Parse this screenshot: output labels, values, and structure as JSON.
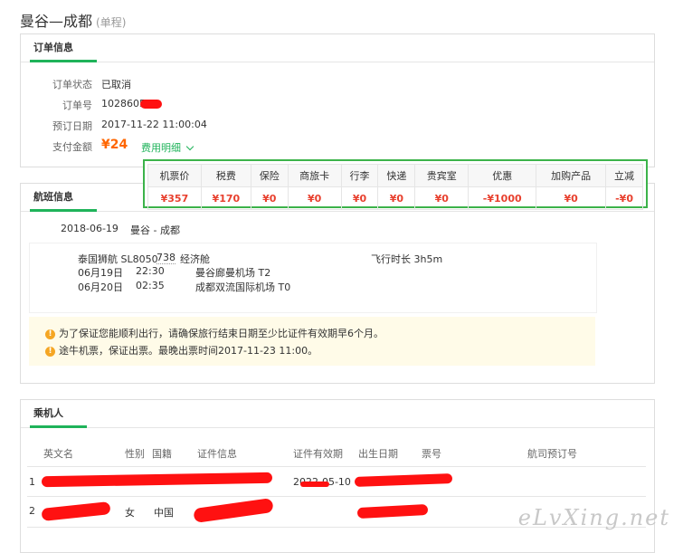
{
  "header": {
    "route_title": "曼谷—成都",
    "trip_type": "(单程)"
  },
  "order_info": {
    "tab_label": "订单信息",
    "status_label": "订单状态",
    "status_value": "已取消",
    "order_no_label": "订单号",
    "order_no_value": "1028605",
    "date_label": "预订日期",
    "date_value": "2017-11-22 11:00:04",
    "amount_label": "支付金额",
    "amount_value": "¥24",
    "fee_detail_link": "费用明细"
  },
  "fee_table": {
    "headers": [
      "机票价",
      "税费",
      "保险",
      "商旅卡",
      "行李",
      "快递",
      "贵宾室",
      "优惠",
      "加购产品",
      "立减"
    ],
    "values": [
      "¥357",
      "¥170",
      "¥0",
      "¥0",
      "¥0",
      "¥0",
      "¥0",
      "-¥1000",
      "¥0",
      "-¥0"
    ]
  },
  "flight_info": {
    "tab_label": "航班信息",
    "date": "2018-06-19",
    "route": "曼谷 - 成都",
    "airline": "泰国狮航 SL8050",
    "aircraft": "738",
    "cabin": "经济舱",
    "duration": "飞行时长 3h5m",
    "dep_date": "06月19日",
    "dep_time": "22:30",
    "dep_airport": "曼谷廊曼机场 T2",
    "arr_date": "06月20日",
    "arr_time": "02:35",
    "arr_airport": "成都双流国际机场 T0",
    "notice_1": "为了保证您能顺利出行，请确保旅行结束日期至少比证件有效期早6个月。",
    "notice_2": "途牛机票，保证出票。最晚出票时间2017-11-23 11:00。"
  },
  "passengers": {
    "tab_label": "乘机人",
    "headers": {
      "name": "英文名",
      "gender": "性别",
      "nationality": "国籍",
      "id_info": "证件信息",
      "id_expiry": "证件有效期",
      "birth": "出生日期",
      "ticket_no": "票号",
      "airline_booking": "航司预订号"
    },
    "rows": [
      {
        "index": "1",
        "gender": "",
        "nationality": "",
        "id_expiry": "2022-05-10"
      },
      {
        "index": "2",
        "gender": "女",
        "nationality": "中国",
        "id_expiry": ""
      }
    ]
  },
  "watermark": "eLvXing.net",
  "colors": {
    "accent": "#1fb35a",
    "price": "#ff6600",
    "fee_value": "#e8402e",
    "redaction": "#ff1111"
  }
}
